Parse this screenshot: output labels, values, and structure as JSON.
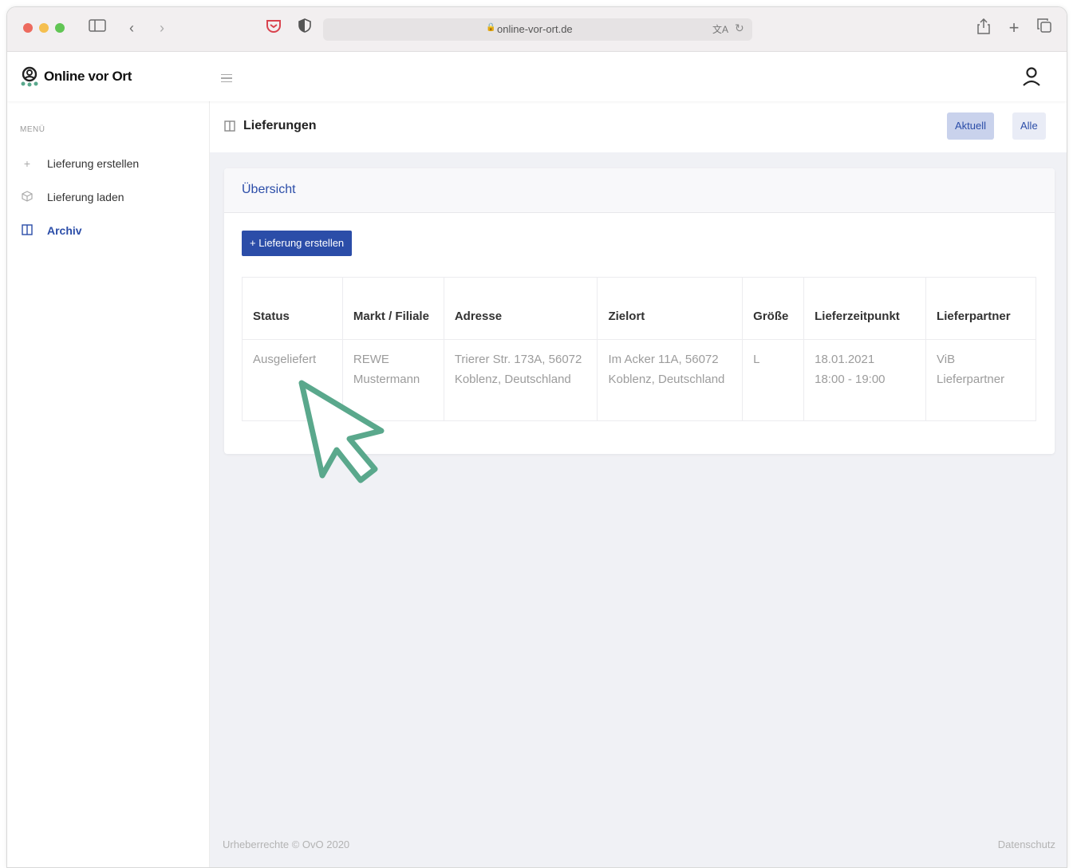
{
  "browser": {
    "url": "online-vor-ort.de"
  },
  "app": {
    "logo_text": "Online vor Ort"
  },
  "sidebar": {
    "menu_label": "MENÜ",
    "items": [
      {
        "label": "Lieferung erstellen",
        "icon": "plus-icon"
      },
      {
        "label": "Lieferung laden",
        "icon": "box-icon"
      },
      {
        "label": "Archiv",
        "icon": "archive-icon",
        "active": true
      }
    ]
  },
  "page": {
    "title": "Lieferungen",
    "tabs": [
      {
        "label": "Aktuell",
        "active": true
      },
      {
        "label": "Alle",
        "active": false
      }
    ]
  },
  "card": {
    "title": "Übersicht",
    "create_button": "+ Lieferung erstellen"
  },
  "table": {
    "headers": [
      "Status",
      "Markt / Filiale",
      "Adresse",
      "Zielort",
      "Größe",
      "Lieferzeitpunkt",
      "Lieferpartner"
    ],
    "rows": [
      {
        "status": "Ausgeliefert",
        "markt": "REWE Mustermann",
        "adresse": "Trierer Str. 173A, 56072 Koblenz, Deutschland",
        "zielort": "Im Acker 11A, 56072 Koblenz, Deutschland",
        "groesse": "L",
        "zeitpunkt_date": "18.01.2021",
        "zeitpunkt_time": "18:00 - 19:00",
        "partner": "ViB Lieferpartner"
      }
    ]
  },
  "footer": {
    "copyright": "Urheberrechte © OvO 2020",
    "privacy": "Datenschutz"
  },
  "colors": {
    "accent": "#2b4da8",
    "cursor": "#5aa88c"
  }
}
